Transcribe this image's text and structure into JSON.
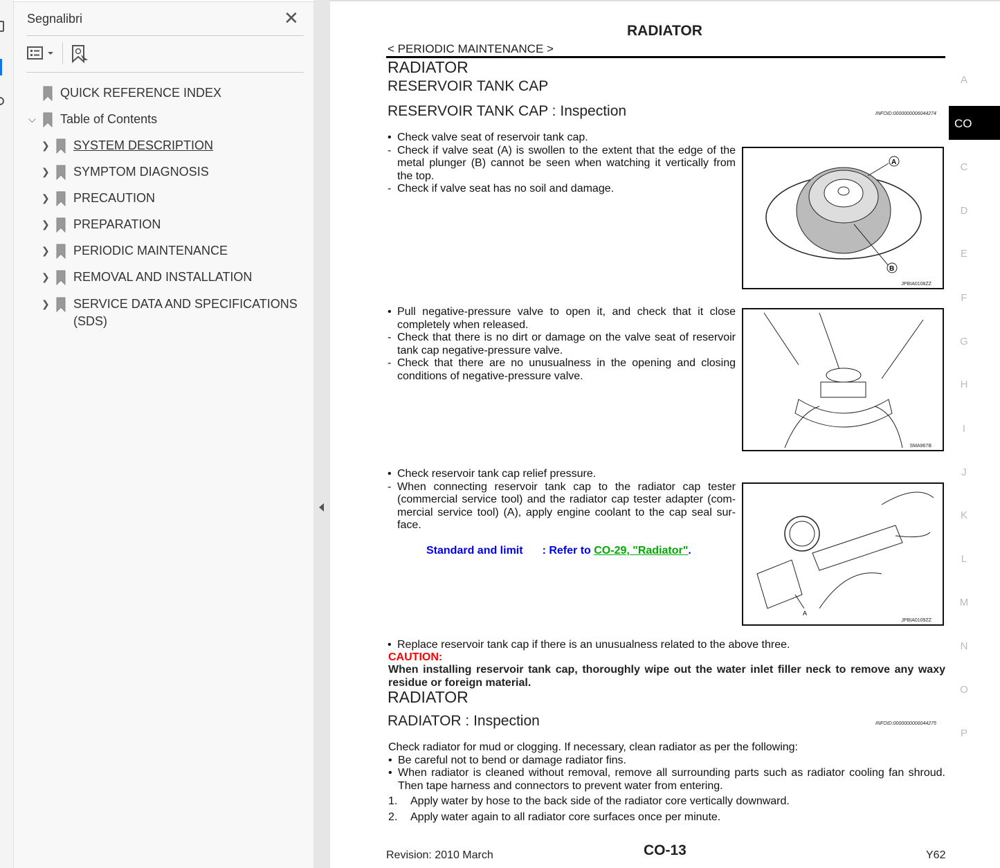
{
  "bookmarks_panel": {
    "title": "Segnalibri",
    "items": [
      {
        "label": "QUICK REFERENCE INDEX",
        "level": 0,
        "expander": "none"
      },
      {
        "label": "Table of Contents",
        "level": 0,
        "expander": "expanded"
      },
      {
        "label": "SYSTEM DESCRIPTION",
        "level": 1,
        "expander": "collapsed",
        "underlined": true
      },
      {
        "label": "SYMPTOM DIAGNOSIS",
        "level": 1,
        "expander": "collapsed"
      },
      {
        "label": "PRECAUTION",
        "level": 1,
        "expander": "collapsed"
      },
      {
        "label": "PREPARATION",
        "level": 1,
        "expander": "collapsed"
      },
      {
        "label": "PERIODIC MAINTENANCE",
        "level": 1,
        "expander": "collapsed"
      },
      {
        "label": "REMOVAL AND INSTALLATION",
        "level": 1,
        "expander": "collapsed"
      },
      {
        "label": "SERVICE DATA AND SPECIFICATIONS",
        "label2": "(SDS)",
        "level": 1,
        "expander": "collapsed"
      }
    ]
  },
  "page": {
    "header_title": "RADIATOR",
    "breadcrumb": "< PERIODIC MAINTENANCE >",
    "h1": "RADIATOR",
    "h2": "RESERVOIR TANK CAP",
    "h3": "RESERVOIR TANK CAP : Inspection",
    "infoid1": "INFOID:0000000006044274",
    "section_tab": "CO",
    "block1": [
      "Check valve seat of reservoir tank cap.",
      "Check if valve seat (A) is swollen to the extent that the edge of the metal plunger (B) cannot be seen when watching it vertically from the top.",
      "Check if valve seat has no soil and damage."
    ],
    "fig1": {
      "caption": "JPBIA0108ZZ",
      "label_a": "A",
      "label_b": "B"
    },
    "block2": [
      "Pull negative-pressure valve to open it, and check that it close completely when released.",
      "Check that there is no dirt or damage on the valve seat of reservoir tank cap negative-pressure valve.",
      "Check that there are no unusualness in the opening and closing conditions of negative-pressure valve."
    ],
    "fig2": {
      "caption": "SMA967B"
    },
    "block3": [
      "Check reservoir tank cap relief pressure.",
      "When connecting reservoir tank cap to the radiator cap tester (commercial service tool) and the radiator cap tester adapter (com-mercial service tool) (A), apply engine coolant to the cap seal sur-face."
    ],
    "standard_label": "Standard and limit",
    "standard_refer": ": Refer to ",
    "standard_link": "CO-29, \"Radiator\"",
    "standard_end": ".",
    "fig3": {
      "caption": "JPBIA0109ZZ",
      "label_a": "A"
    },
    "replace": "Replace reservoir tank cap if there is an unusualness related to the above three.",
    "caution_label": "CAUTION:",
    "caution_text": "When installing reservoir tank cap, thoroughly wipe out the water inlet filler neck to remove any waxy residue or foreign material.",
    "h2b": "RADIATOR",
    "h3b": "RADIATOR : Inspection",
    "infoid2": "INFOID:0000000006044275",
    "rad_intro": "Check radiator for mud or clogging. If necessary, clean radiator as per the following:",
    "rad_bullets": [
      "Be careful not to bend or damage radiator fins.",
      "When radiator is cleaned without removal, remove all surrounding parts such as radiator cooling fan shroud. Then tape harness and connectors to prevent water from entering."
    ],
    "rad_steps": [
      {
        "n": "1.",
        "text": "Apply water by hose to the back side of the radiator core vertically downward."
      },
      {
        "n": "2.",
        "text": "Apply water again to all radiator core surfaces once per minute."
      }
    ],
    "footer_revision": "Revision: 2010 March",
    "footer_page": "CO-13",
    "footer_model": "Y62",
    "side_letters": [
      "A",
      "C",
      "D",
      "E",
      "F",
      "G",
      "H",
      "I",
      "J",
      "K",
      "L",
      "M",
      "N",
      "O",
      "P"
    ]
  },
  "colors": {
    "link_blue": "#0000ee",
    "link_green": "#00aa00",
    "caution_red": "#ff0000",
    "tab_active": "#000000"
  }
}
